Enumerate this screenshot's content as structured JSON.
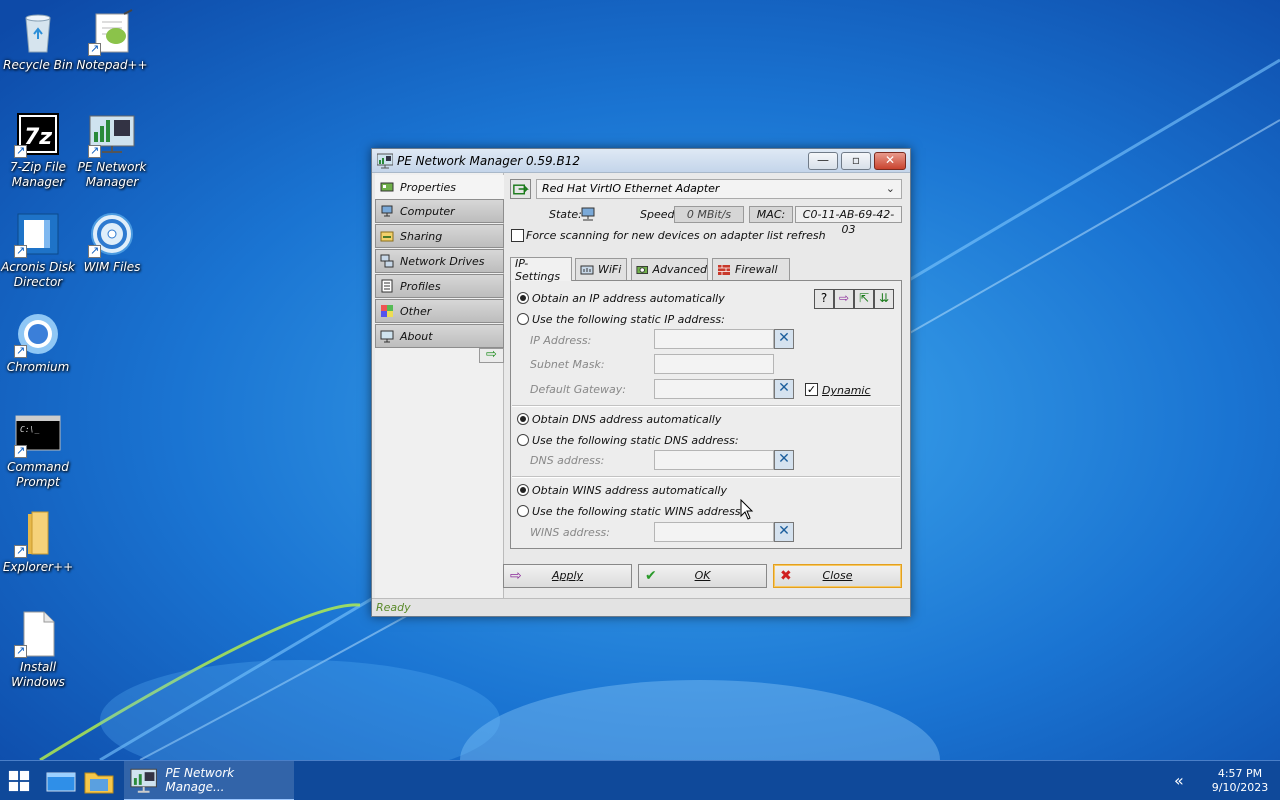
{
  "desktop": {
    "icons": [
      {
        "label": "Recycle Bin"
      },
      {
        "label": "Notepad++"
      },
      {
        "label": "7-Zip File Manager"
      },
      {
        "label": "PE Network Manager"
      },
      {
        "label": "Acronis Disk Director"
      },
      {
        "label": "WIM Files"
      },
      {
        "label": "Chromium"
      },
      {
        "label": "Command Prompt"
      },
      {
        "label": "Explorer++"
      },
      {
        "label": "Install Windows"
      }
    ]
  },
  "window": {
    "title": "PE Network Manager 0.59.B12",
    "nav": [
      {
        "label": "Properties"
      },
      {
        "label": "Computer"
      },
      {
        "label": "Sharing"
      },
      {
        "label": "Network Drives"
      },
      {
        "label": "Profiles"
      },
      {
        "label": "Other"
      },
      {
        "label": "About"
      }
    ],
    "adapter": "Red Hat VirtIO Ethernet Adapter",
    "state_label": "State:",
    "speed_label": "Speed:",
    "speed_value": "0 MBit/s",
    "mac_label": "MAC:",
    "mac_value": "C0-11-AB-69-42-03",
    "force_scan_label": "Force scanning for new devices on adapter list refresh",
    "tabs": [
      {
        "label": "IP-Settings"
      },
      {
        "label": "WiFi"
      },
      {
        "label": "Advanced"
      },
      {
        "label": "Firewall"
      }
    ],
    "ip": {
      "auto_label": "Obtain an IP address automatically",
      "static_label": "Use the following static IP address:",
      "ip_address_label": "IP Address:",
      "subnet_label": "Subnet Mask:",
      "gateway_label": "Default Gateway:",
      "dynamic_label": "Dynamic",
      "dns_auto_label": "Obtain DNS address automatically",
      "dns_static_label": "Use the following static DNS address:",
      "dns_field_label": "DNS address:",
      "wins_auto_label": "Obtain WINS address automatically",
      "wins_static_label": "Use the following static WINS address:",
      "wins_field_label": "WINS address:"
    },
    "buttons": {
      "apply": "Apply",
      "ok": "OK",
      "close": "Close"
    },
    "status": "Ready"
  },
  "taskbar": {
    "task_label": "PE Network Manage...",
    "time": "4:57 PM",
    "date": "9/10/2023"
  },
  "colors": {
    "accent": "#1565c8",
    "close_red": "#c9442f"
  }
}
